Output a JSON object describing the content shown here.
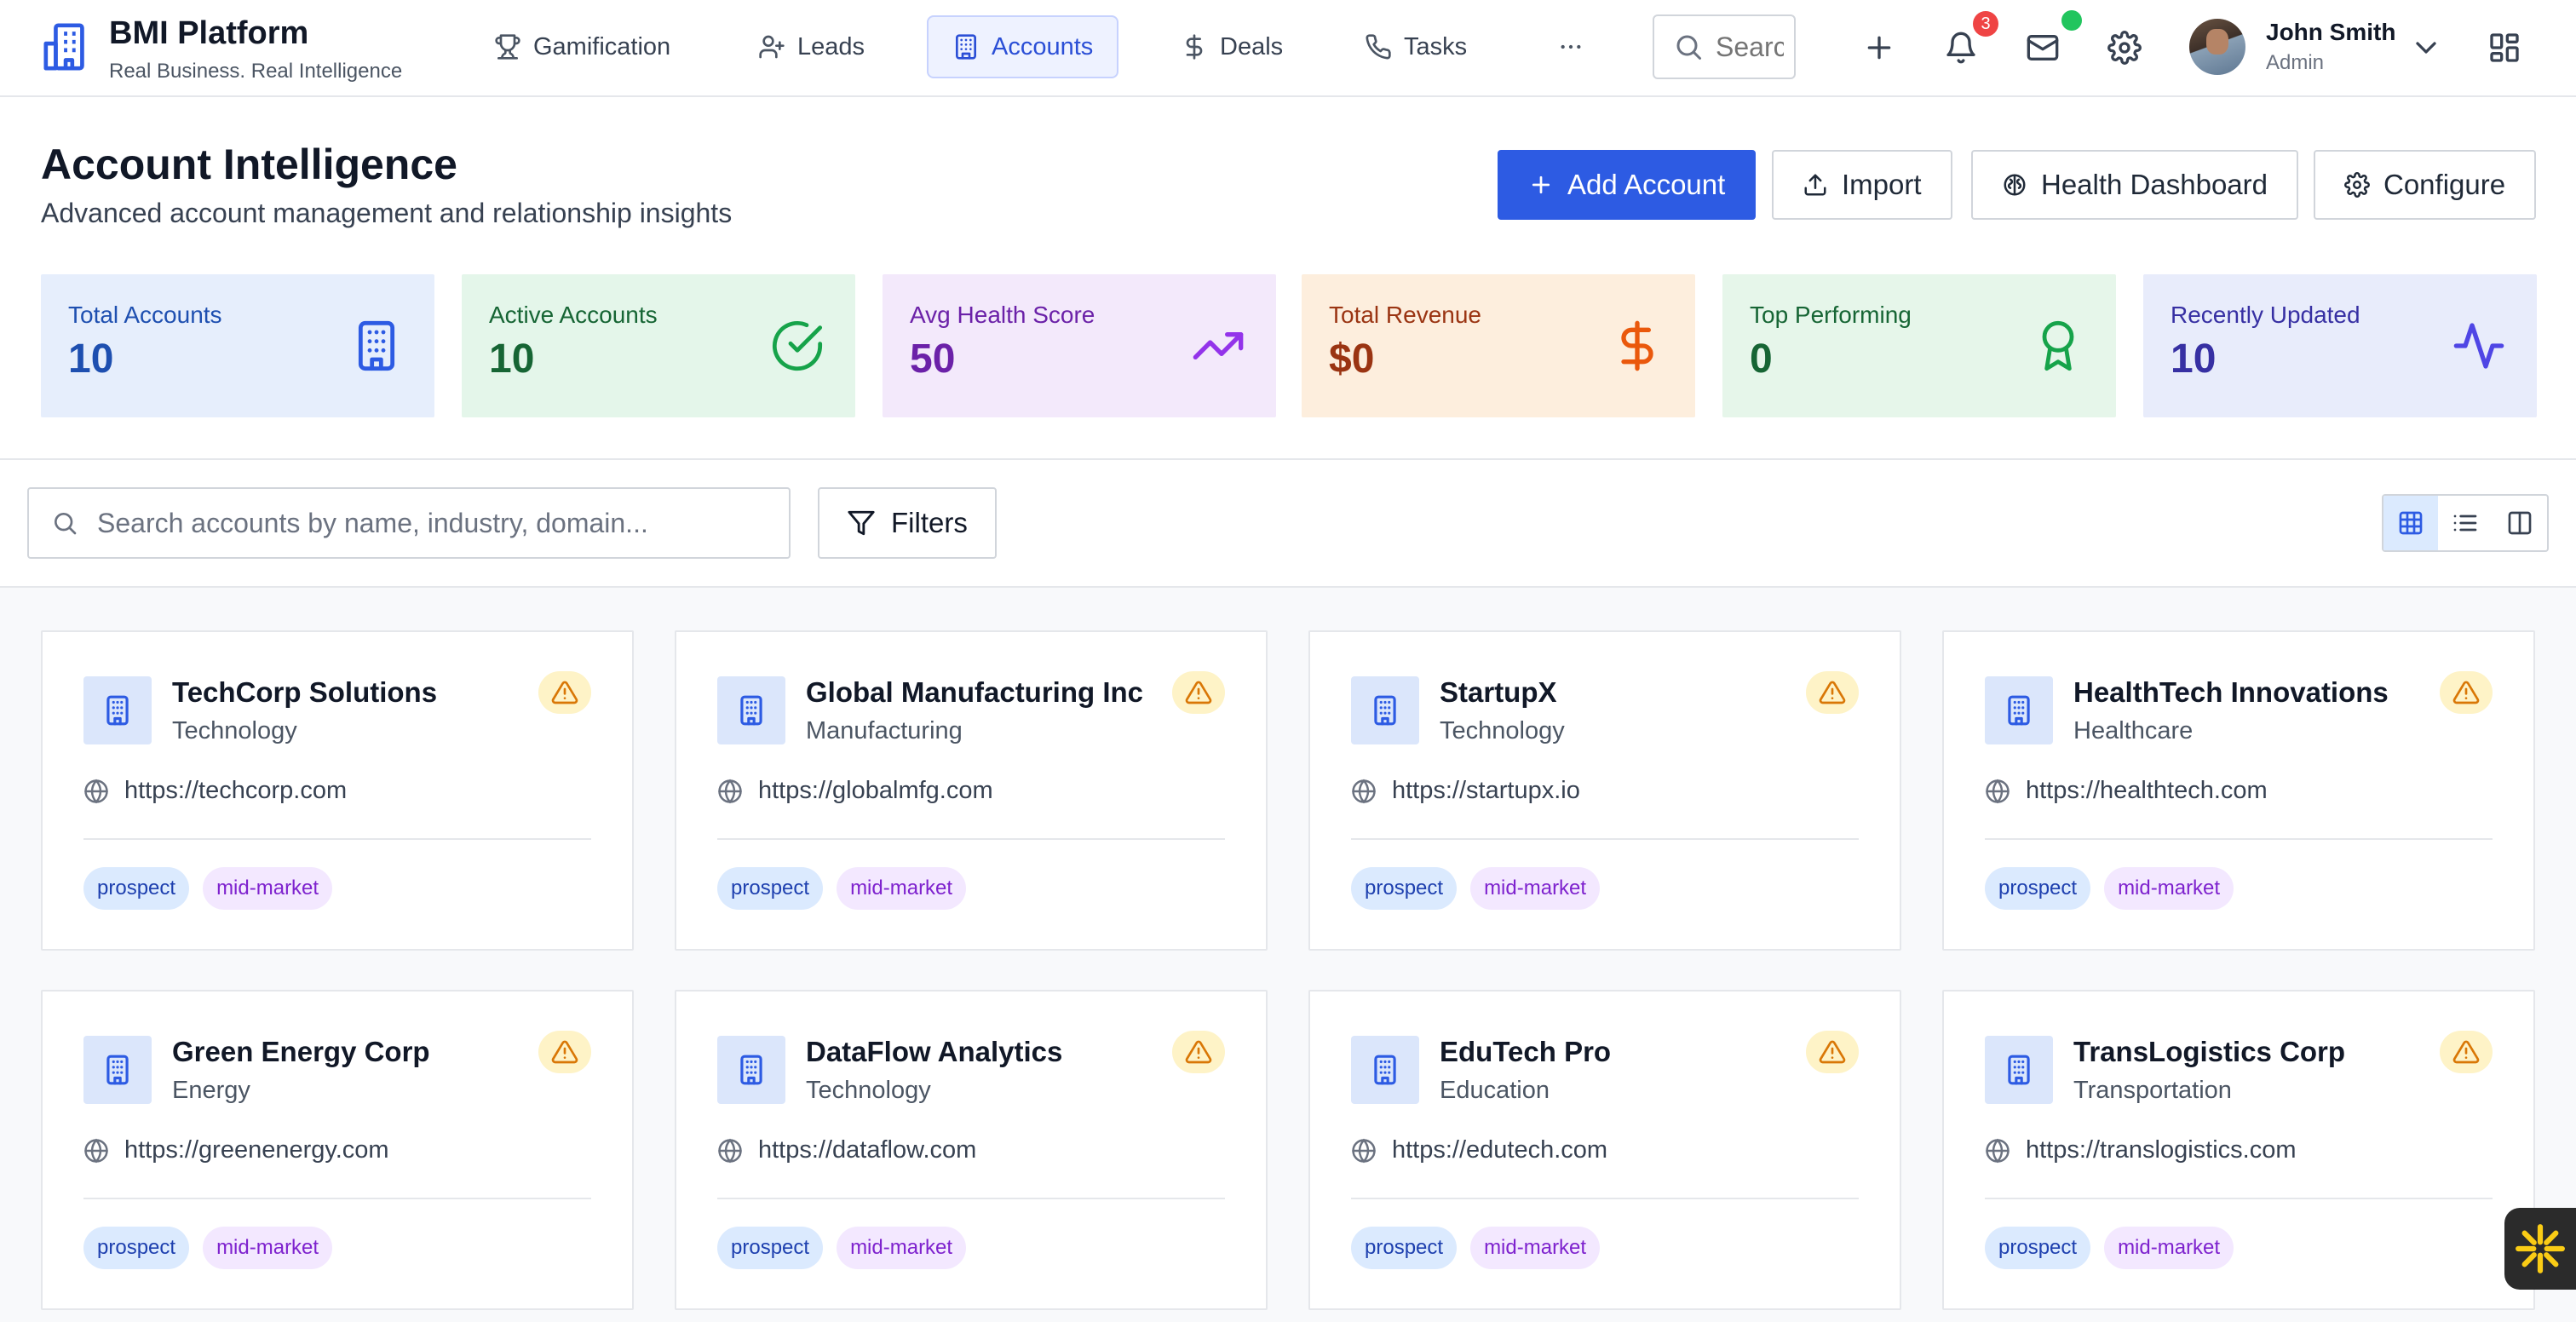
{
  "brand": {
    "title": "BMI Platform",
    "subtitle": "Real Business. Real Intelligence"
  },
  "nav": [
    {
      "label": "Gamification",
      "icon": "trophy-icon"
    },
    {
      "label": "Leads",
      "icon": "user-plus-icon"
    },
    {
      "label": "Accounts",
      "icon": "building-icon",
      "active": true
    },
    {
      "label": "Deals",
      "icon": "dollar-icon"
    },
    {
      "label": "Tasks",
      "icon": "phone-icon"
    }
  ],
  "topbar": {
    "search_placeholder": "Search",
    "notification_count": "3",
    "user_name": "John Smith",
    "user_role": "Admin"
  },
  "header": {
    "title": "Account Intelligence",
    "subtitle": "Advanced account management and relationship insights",
    "add_label": "Add Account",
    "import_label": "Import",
    "health_label": "Health Dashboard",
    "configure_label": "Configure"
  },
  "stats": [
    {
      "label": "Total Accounts",
      "value": "10",
      "icon": "building-icon",
      "bg": "#e6eefc",
      "color": "#1e4fb0"
    },
    {
      "label": "Active Accounts",
      "value": "10",
      "icon": "check-circle-icon",
      "bg": "#e4f6ea",
      "color": "#166534"
    },
    {
      "label": "Avg Health Score",
      "value": "50",
      "icon": "trending-up-icon",
      "bg": "#f3e9fb",
      "color": "#6b21a8"
    },
    {
      "label": "Total Revenue",
      "value": "$0",
      "icon": "dollar-icon",
      "bg": "#fdeedd",
      "color": "#9a3412"
    },
    {
      "label": "Top Performing",
      "value": "0",
      "icon": "award-icon",
      "bg": "#e6f6ea",
      "color": "#166534"
    },
    {
      "label": "Recently Updated",
      "value": "10",
      "icon": "activity-icon",
      "bg": "#e8ecfb",
      "color": "#3730a3"
    }
  ],
  "toolbar": {
    "search_placeholder": "Search accounts by name, industry, domain...",
    "filters_label": "Filters"
  },
  "accounts": [
    {
      "name": "TechCorp Solutions",
      "industry": "Technology",
      "website": "https://techcorp.com",
      "tags": [
        "prospect",
        "mid-market"
      ]
    },
    {
      "name": "Global Manufacturing Inc",
      "industry": "Manufacturing",
      "website": "https://globalmfg.com",
      "tags": [
        "prospect",
        "mid-market"
      ]
    },
    {
      "name": "StartupX",
      "industry": "Technology",
      "website": "https://startupx.io",
      "tags": [
        "prospect",
        "mid-market"
      ]
    },
    {
      "name": "HealthTech Innovations",
      "industry": "Healthcare",
      "website": "https://healthtech.com",
      "tags": [
        "prospect",
        "mid-market"
      ]
    },
    {
      "name": "Green Energy Corp",
      "industry": "Energy",
      "website": "https://greenenergy.com",
      "tags": [
        "prospect",
        "mid-market"
      ]
    },
    {
      "name": "DataFlow Analytics",
      "industry": "Technology",
      "website": "https://dataflow.com",
      "tags": [
        "prospect",
        "mid-market"
      ]
    },
    {
      "name": "EduTech Pro",
      "industry": "Education",
      "website": "https://edutech.com",
      "tags": [
        "prospect",
        "mid-market"
      ]
    },
    {
      "name": "TransLogistics Corp",
      "industry": "Transportation",
      "website": "https://translogistics.com",
      "tags": [
        "prospect",
        "mid-market"
      ]
    }
  ],
  "colors": {
    "primary": "#2d5be3",
    "warning_bg": "#fef3c7",
    "warning_icon": "#d97706"
  }
}
